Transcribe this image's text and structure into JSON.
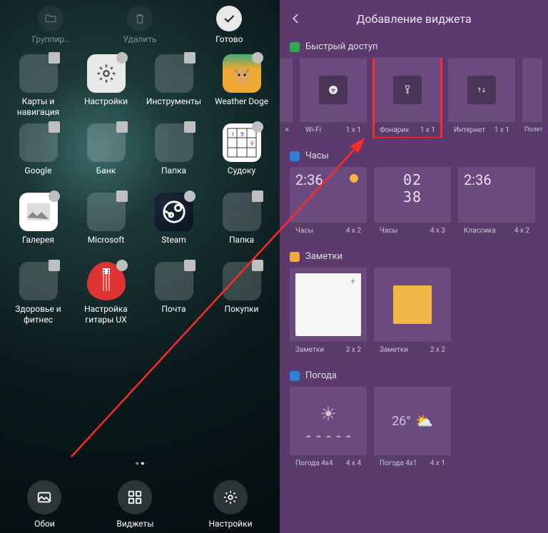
{
  "left": {
    "top": {
      "group": "Группир..",
      "delete": "Удалить",
      "done": "Готово"
    },
    "apps": [
      {
        "label": "Карты и навигация",
        "kind": "folder",
        "colors": [
          "#2f6df0",
          "#e8e8e8",
          "#f0b400",
          "#cc3c3c",
          "#6c9",
          "#ddd",
          "#c66",
          "#6cf",
          "#ccc"
        ]
      },
      {
        "label": "Настройки",
        "kind": "settings"
      },
      {
        "label": "Инструменты",
        "kind": "folder",
        "colors": [
          "#e8e8e8",
          "#5a4",
          "#4af",
          "#f55",
          "#fa0",
          "#ccc",
          "#9cf",
          "#c9e",
          "#fc6"
        ]
      },
      {
        "label": "Weather Doge",
        "kind": "doge"
      },
      {
        "label": "Google",
        "kind": "folder",
        "colors": [
          "#e84",
          "#4a8",
          "#48f",
          "#fb3",
          "#e33",
          "#0b8",
          "#f66",
          "#4bf",
          "#fc4"
        ]
      },
      {
        "label": "Банк",
        "kind": "folder",
        "colors": [
          "#1a7",
          "#fc3",
          "#e33",
          "#04a",
          "#f84",
          "#ccc",
          "#fa0",
          "#9cf",
          "#c9e"
        ]
      },
      {
        "label": "Папка",
        "kind": "folder",
        "colors": [
          "#e33",
          "#07c",
          "#fc3",
          "#1a7",
          "#f84",
          "#4af",
          "#c66",
          "#6cf",
          "#ccc"
        ]
      },
      {
        "label": "Судоку",
        "kind": "sudoku"
      },
      {
        "label": "Галерея",
        "kind": "gallery"
      },
      {
        "label": "Microsoft",
        "kind": "folder",
        "colors": [
          "#e33",
          "#1a7",
          "#07c",
          "#fc3",
          "",
          "",
          "",
          "",
          ""
        ]
      },
      {
        "label": "Steam",
        "kind": "steam"
      },
      {
        "label": "Папка",
        "kind": "folder",
        "colors": [
          "#07c",
          "#fc3",
          "#e33",
          "#1a7",
          "#f84",
          "#4af",
          "#c66",
          "#6cf",
          "#fa0"
        ]
      },
      {
        "label": "Здоровье и фитнес",
        "kind": "folder",
        "colors": [
          "#e33",
          "#1a7",
          "#07c",
          "#fc3",
          "#f84",
          "",
          "",
          "",
          ""
        ]
      },
      {
        "label": "Настройка гитары UX",
        "kind": "guitar"
      },
      {
        "label": "Почта",
        "kind": "folder",
        "colors": [
          "#07c",
          "#e33",
          "#1a7",
          "#fc3",
          "#4af",
          "#f84",
          "",
          "",
          ""
        ]
      },
      {
        "label": "Покупки",
        "kind": "folder",
        "colors": [
          "#e33",
          "#07c",
          "#1a7",
          "#fc3",
          "#f84",
          "#4af",
          "",
          "",
          ""
        ]
      }
    ],
    "bottom": {
      "wallpapers": "Обои",
      "widgets": "Виджеты",
      "settings": "Настройки"
    }
  },
  "right": {
    "title": "Добавление виджета",
    "sections": {
      "quick": {
        "title": "Быстрый доступ",
        "color": "#2fa84f",
        "items": [
          {
            "label": "к",
            "size": ""
          },
          {
            "label": "Wi-Fi",
            "size": "1 x 1",
            "icon": "wifi"
          },
          {
            "label": "Фонарик",
            "size": "1 x 1",
            "icon": "flash",
            "hl": true
          },
          {
            "label": "Интернет",
            "size": "1 x 1",
            "icon": "data"
          },
          {
            "label": "Полет",
            "size": ""
          }
        ]
      },
      "clock": {
        "title": "Часы",
        "color": "#2f7fd4",
        "items": [
          {
            "label": "Часы",
            "size": "4 x 2",
            "text": "2:36",
            "sun": true
          },
          {
            "label": "Часы",
            "size": "4 x 3",
            "text": "02\n38",
            "dig": true
          },
          {
            "label": "Классика",
            "size": "4 x 2",
            "text": "2:36"
          }
        ]
      },
      "notes": {
        "title": "Заметки",
        "color": "#f0a93a",
        "items": [
          {
            "label": "Заметки",
            "size": "2 x 2",
            "style": "white"
          },
          {
            "label": "Заметки",
            "size": "2 x 2",
            "style": "yellow"
          }
        ]
      },
      "weather": {
        "title": "Погода",
        "color": "#2f7fd4",
        "items": [
          {
            "label": "Погода 4x4",
            "size": "4 x 4",
            "temp": "",
            "icon": "sun"
          },
          {
            "label": "Погода 4x1",
            "size": "4 x 1",
            "temp": "26°",
            "icon": "suncloud"
          }
        ]
      }
    }
  }
}
